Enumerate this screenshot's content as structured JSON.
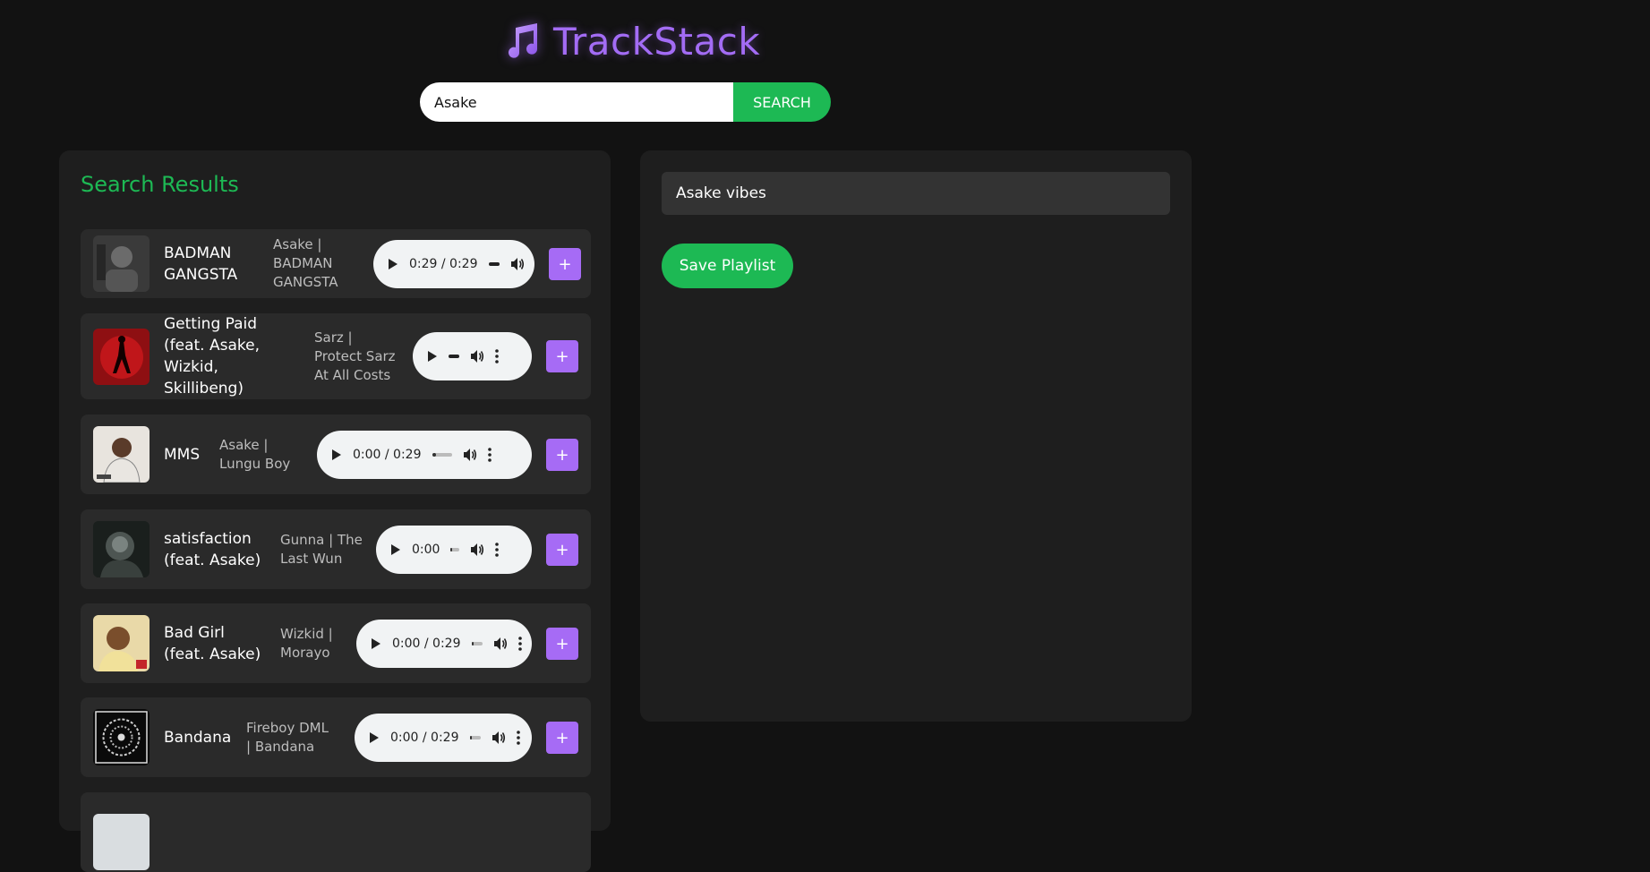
{
  "app": {
    "title": "TrackStack",
    "logo_icon": "music-note-icon",
    "accent": "#a36cf5"
  },
  "search": {
    "value": "Asake",
    "placeholder": "Search",
    "button_label": "SEARCH",
    "button_color": "#1db954"
  },
  "results": {
    "title": "Search Results",
    "tracks": [
      {
        "title": "BADMAN GANGSTA",
        "meta": "Asake | BADMAN GANGSTA",
        "time": "0:29 / 0:29",
        "progress": 1.0,
        "add_label": "+"
      },
      {
        "title": "Getting Paid (feat. Asake, Wizkid, Skillibeng)",
        "meta": "Sarz | Protect Sarz At All Costs",
        "time": "",
        "progress": 0.0,
        "add_label": "+"
      },
      {
        "title": "MMS",
        "meta": "Asake | Lungu Boy",
        "time": "0:00 / 0:29",
        "progress": 0.0,
        "add_label": "+"
      },
      {
        "title": "satisfaction (feat. Asake)",
        "meta": "Gunna | The Last Wun",
        "time": "0:00",
        "progress": 0.0,
        "add_label": "+"
      },
      {
        "title": "Bad Girl (feat. Asake)",
        "meta": "Wizkid | Morayo",
        "time": "0:00 / 0:29",
        "progress": 0.0,
        "add_label": "+"
      },
      {
        "title": "Bandana",
        "meta": "Fireboy DML | Bandana",
        "time": "0:00 / 0:29",
        "progress": 0.0,
        "add_label": "+"
      }
    ]
  },
  "playlist": {
    "name": "Asake vibes",
    "save_label": "Save Playlist"
  },
  "colors": {
    "background": "#121212",
    "panel": "#1e1e1e",
    "row": "#2a2a2a",
    "green": "#1db954",
    "purple": "#a66bf5"
  }
}
